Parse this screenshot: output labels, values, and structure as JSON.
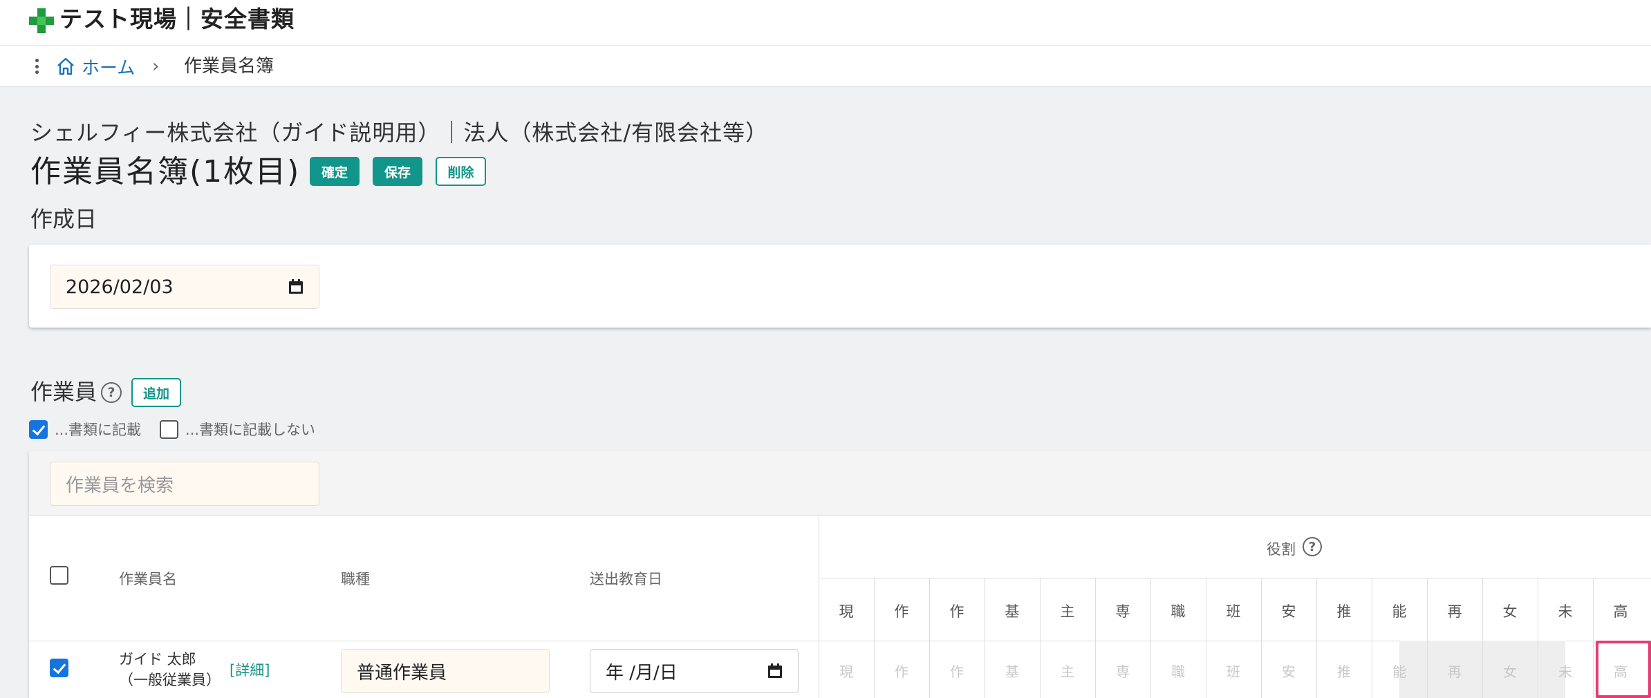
{
  "header": {
    "app_title": "テスト現場｜安全書類",
    "brand_color": "#2a9a3a"
  },
  "breadcrumb": {
    "home": "ホーム",
    "separator": "›",
    "current": "作業員名簿"
  },
  "document": {
    "company_line": "シェルフィー株式会社（ガイド説明用）｜法人（株式会社/有限会社等）",
    "title": "作業員名簿(1枚目)",
    "confirm_label": "確定",
    "save_label": "保存",
    "delete_label": "削除"
  },
  "created_date": {
    "label": "作成日",
    "value": "2026/02/03"
  },
  "workers": {
    "label": "作業員",
    "help": "?",
    "add_label": "追加",
    "filter_include": "...書類に記載",
    "filter_exclude": "...書類に記載しない",
    "search_placeholder": "作業員を検索",
    "columns": {
      "name": "作業員名",
      "job": "職種",
      "education_date": "送出教育日",
      "roles": "役割",
      "roles_help": "?"
    },
    "role_headers": [
      "現",
      "作",
      "作",
      "基",
      "主",
      "専",
      "職",
      "班",
      "安",
      "推",
      "能",
      "再",
      "女",
      "未",
      "高"
    ],
    "rows": [
      {
        "name": "ガイド 太郎",
        "type": "（一般従業員）",
        "detail": "[詳細]",
        "job": "普通作業員",
        "education_date": "年 /月/日",
        "roles": [
          "現",
          "作",
          "作",
          "基",
          "主",
          "専",
          "職",
          "班",
          "安",
          "推",
          "能",
          "再",
          "女",
          "未",
          "高"
        ]
      }
    ]
  },
  "colors": {
    "accent": "#12958a",
    "link": "#1b72b8",
    "checkbox": "#1674e0",
    "highlight": "#e83a74"
  }
}
